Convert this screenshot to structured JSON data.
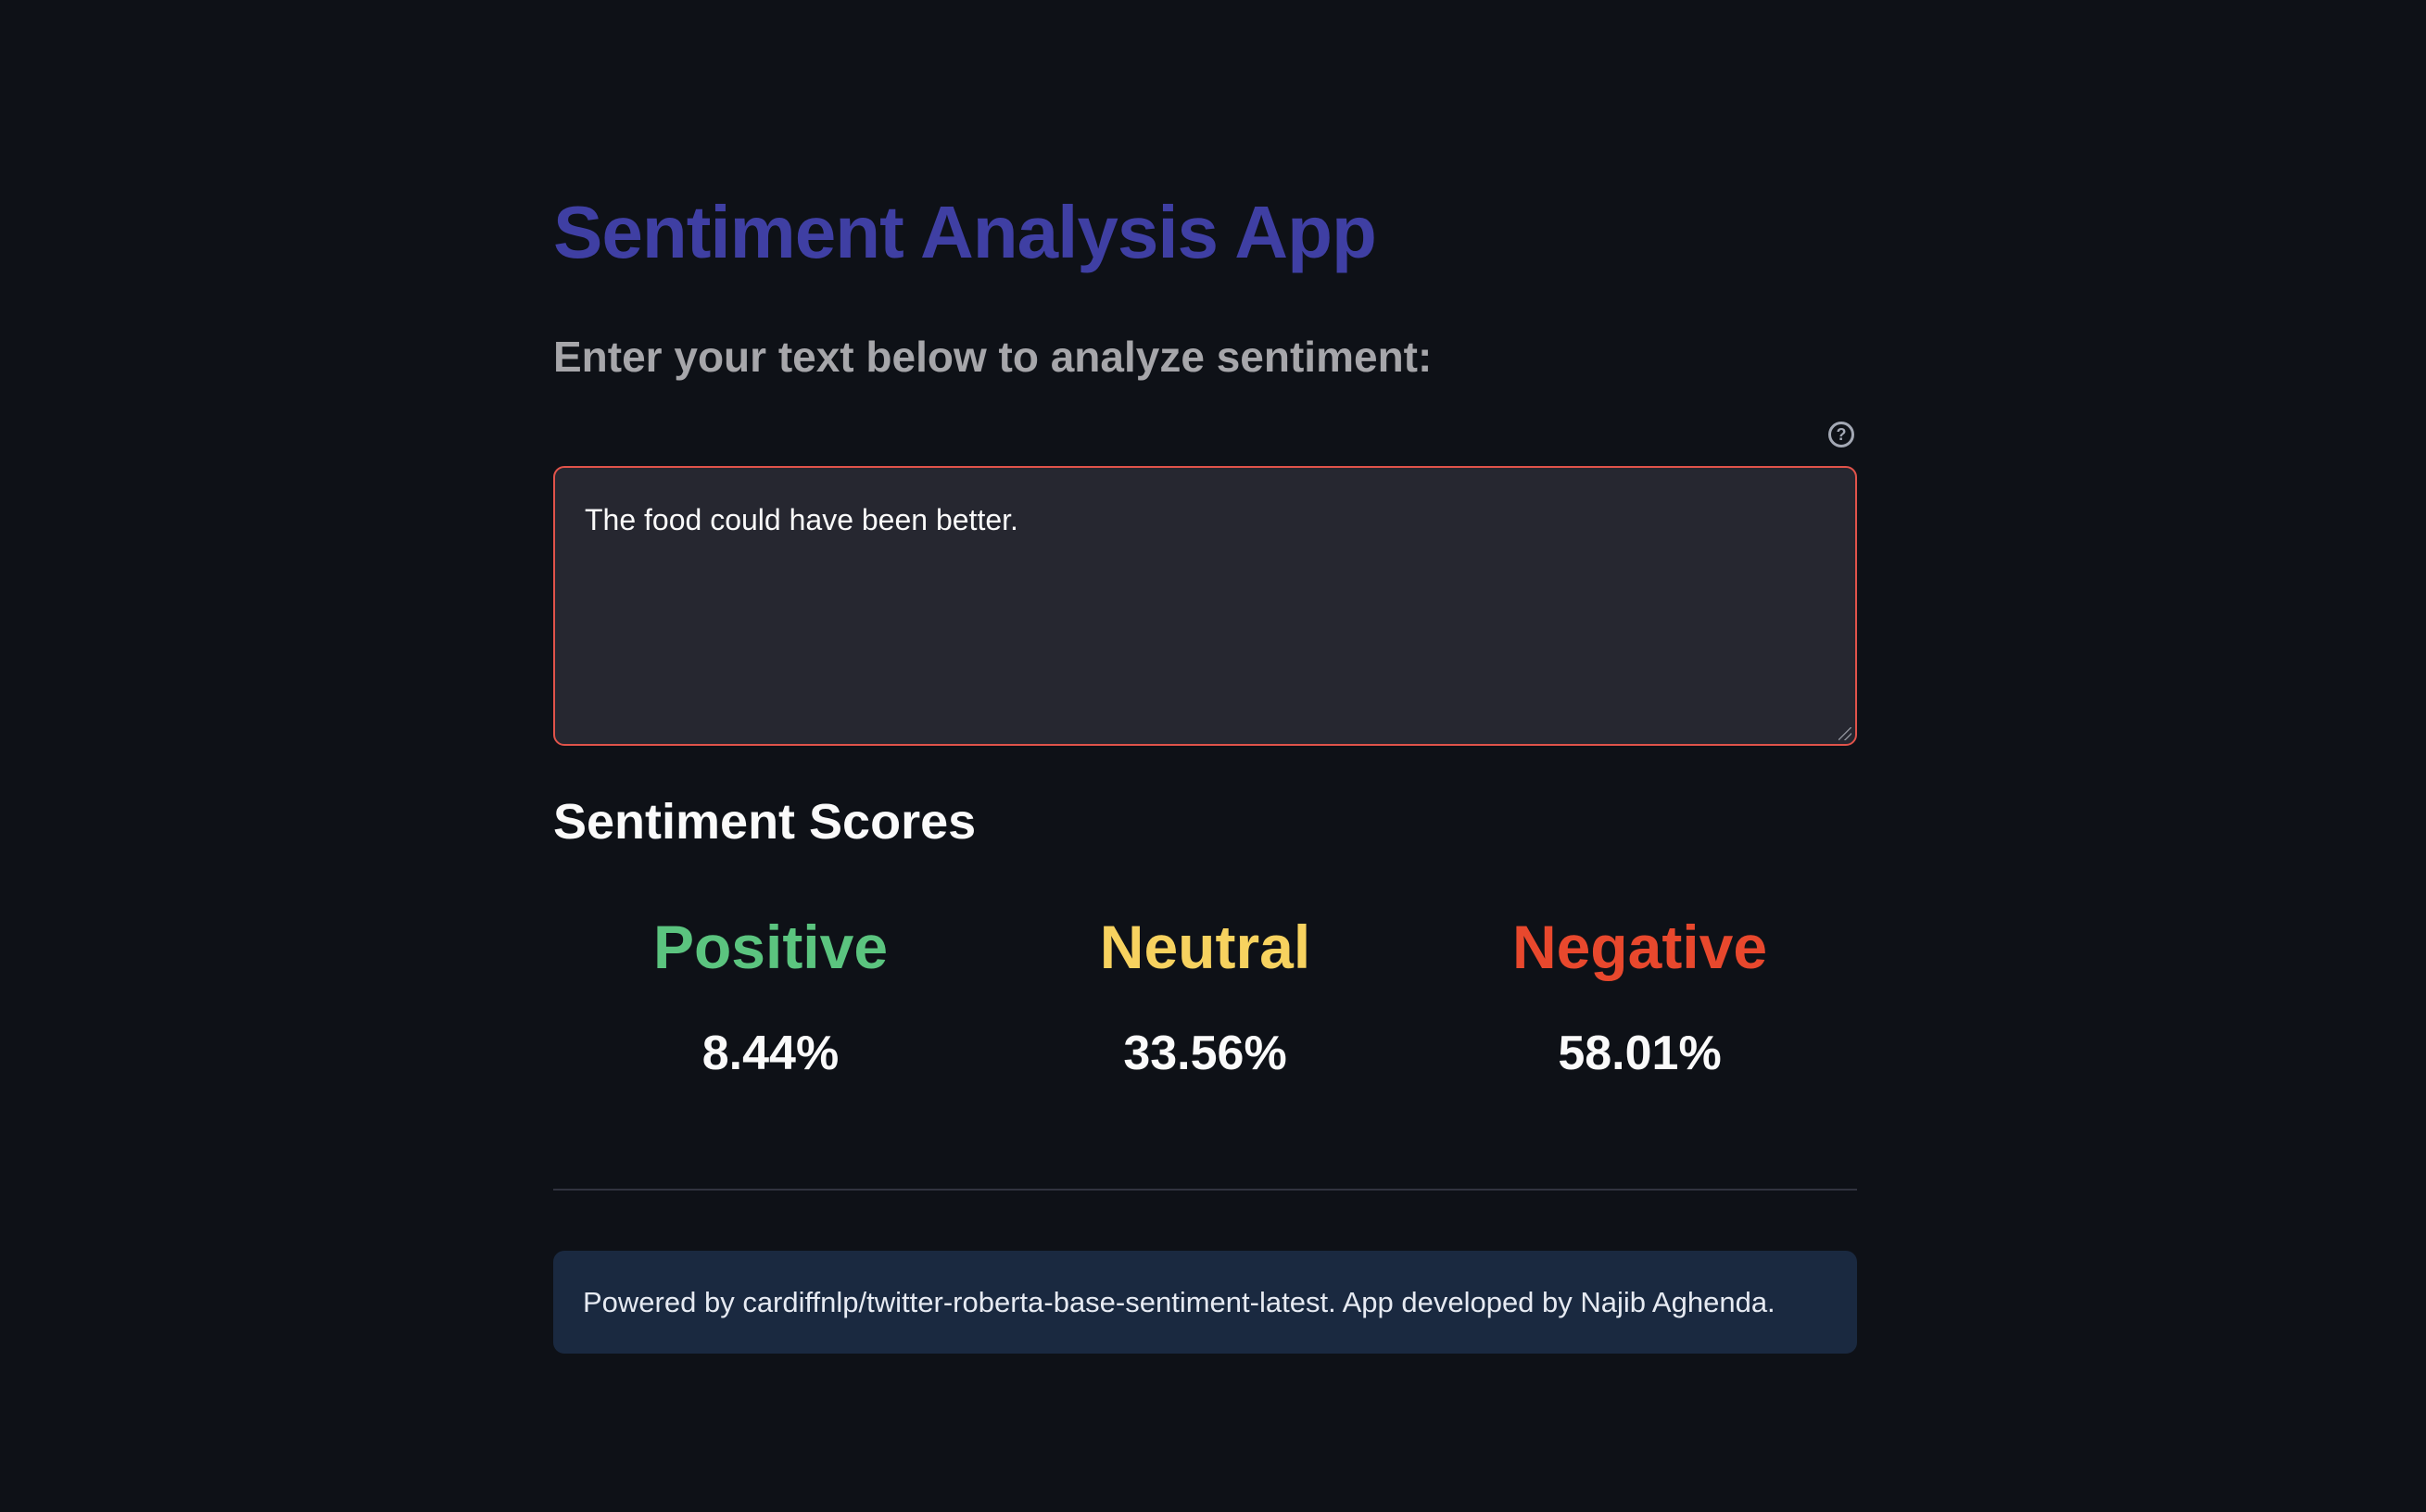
{
  "app": {
    "title": "Sentiment Analysis App",
    "subtitle": "Enter your text below to analyze sentiment:"
  },
  "input": {
    "value": "The food could have been better.",
    "help_icon": "question-circle-icon",
    "border_color": "#e0534a"
  },
  "results": {
    "heading": "Sentiment Scores",
    "scores": [
      {
        "label": "Positive",
        "value": "8.44%",
        "color": "#5bc47f"
      },
      {
        "label": "Neutral",
        "value": "33.56%",
        "color": "#f7d25f"
      },
      {
        "label": "Negative",
        "value": "58.01%",
        "color": "#e8482d"
      }
    ]
  },
  "footer": {
    "text": "Powered by cardiffnlp/twitter-roberta-base-sentiment-latest. App developed by Najib Aghenda."
  },
  "colors": {
    "background": "#0e1117",
    "title": "#3f3fa3",
    "footer_bg": "#1a2940"
  }
}
